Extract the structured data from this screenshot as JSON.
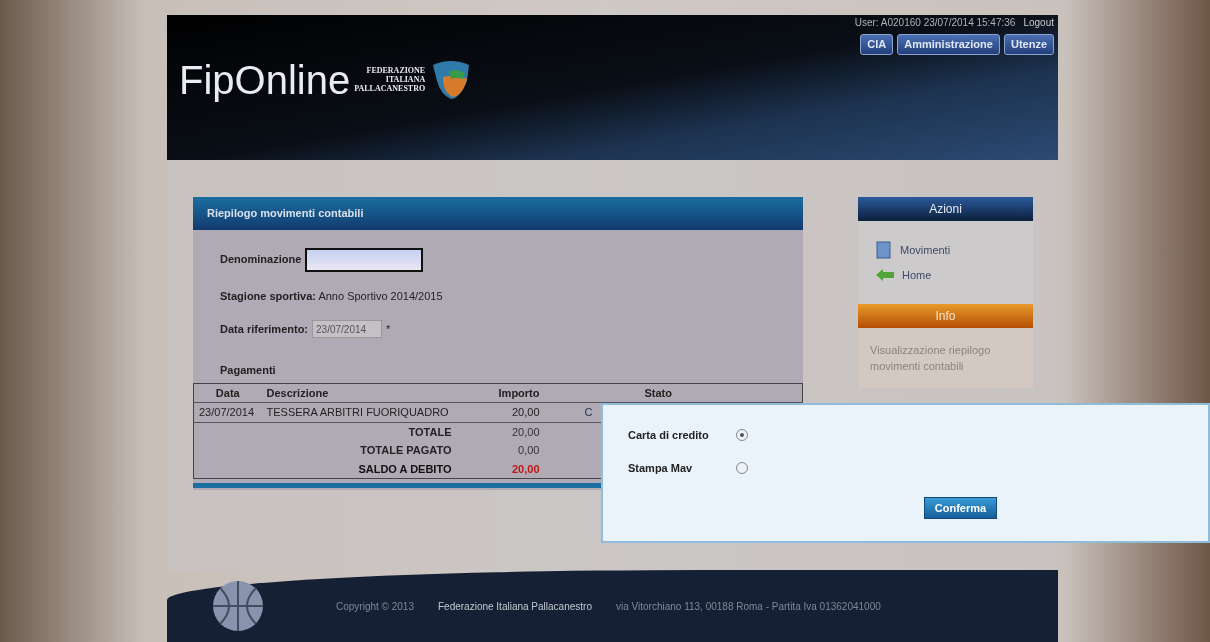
{
  "header": {
    "user_info": "User: A020160 23/07/2014 15:47:36",
    "logout": "Logout",
    "logo": {
      "name": "FipOnline",
      "lines": [
        "FEDERAZIONE",
        "ITALIANA",
        "PALLACANESTRO"
      ]
    },
    "nav": [
      {
        "label": "CIA"
      },
      {
        "label": "Amministrazione"
      },
      {
        "label": "Utenze"
      }
    ]
  },
  "panel": {
    "title": "Riepilogo movimenti contabili",
    "denominazione": {
      "label": "Denominazione"
    },
    "stagione": {
      "label": "Stagione sportiva:",
      "value": "Anno Sportivo 2014/2015"
    },
    "data_riferimento": {
      "label": "Data riferimento:",
      "value": "23/07/2014",
      "required_mark": "*",
      "disabled": true
    },
    "payments_heading": "Pagamenti",
    "table": {
      "columns": [
        "Data",
        "Descrizione",
        "Importo",
        "Stato"
      ],
      "rows": [
        {
          "data": "23/07/2014",
          "descrizione": "TESSERA ARBITRI FUORIQUADRO",
          "importo": "20,00",
          "stato": "C"
        }
      ],
      "totals": [
        {
          "label": "TOTALE",
          "value": "20,00",
          "kind": "normal"
        },
        {
          "label": "TOTALE PAGATO",
          "value": "0,00",
          "kind": "normal"
        },
        {
          "label": "SALDO A DEBITO",
          "value": "20,00",
          "kind": "debit"
        }
      ]
    }
  },
  "sidebar": {
    "actions_title": "Azioni",
    "actions": [
      {
        "label": "Movimenti",
        "kind": "document"
      },
      {
        "label": "Home",
        "kind": "back"
      }
    ],
    "info_title": "Info",
    "info_text": "Visualizzazione riepilogo movimenti contabili"
  },
  "modal": {
    "options": [
      {
        "label": "Carta di credito",
        "selected": true
      },
      {
        "label": "Stampa Mav",
        "selected": false
      }
    ],
    "confirm": "Conferma"
  },
  "footer": {
    "copyright": "Copyright © 2013",
    "organization": "Federazione Italiana Pallacanestro",
    "address": "via Vitorchiano 113, 00188 Roma - Partita Iva 01362041000"
  }
}
